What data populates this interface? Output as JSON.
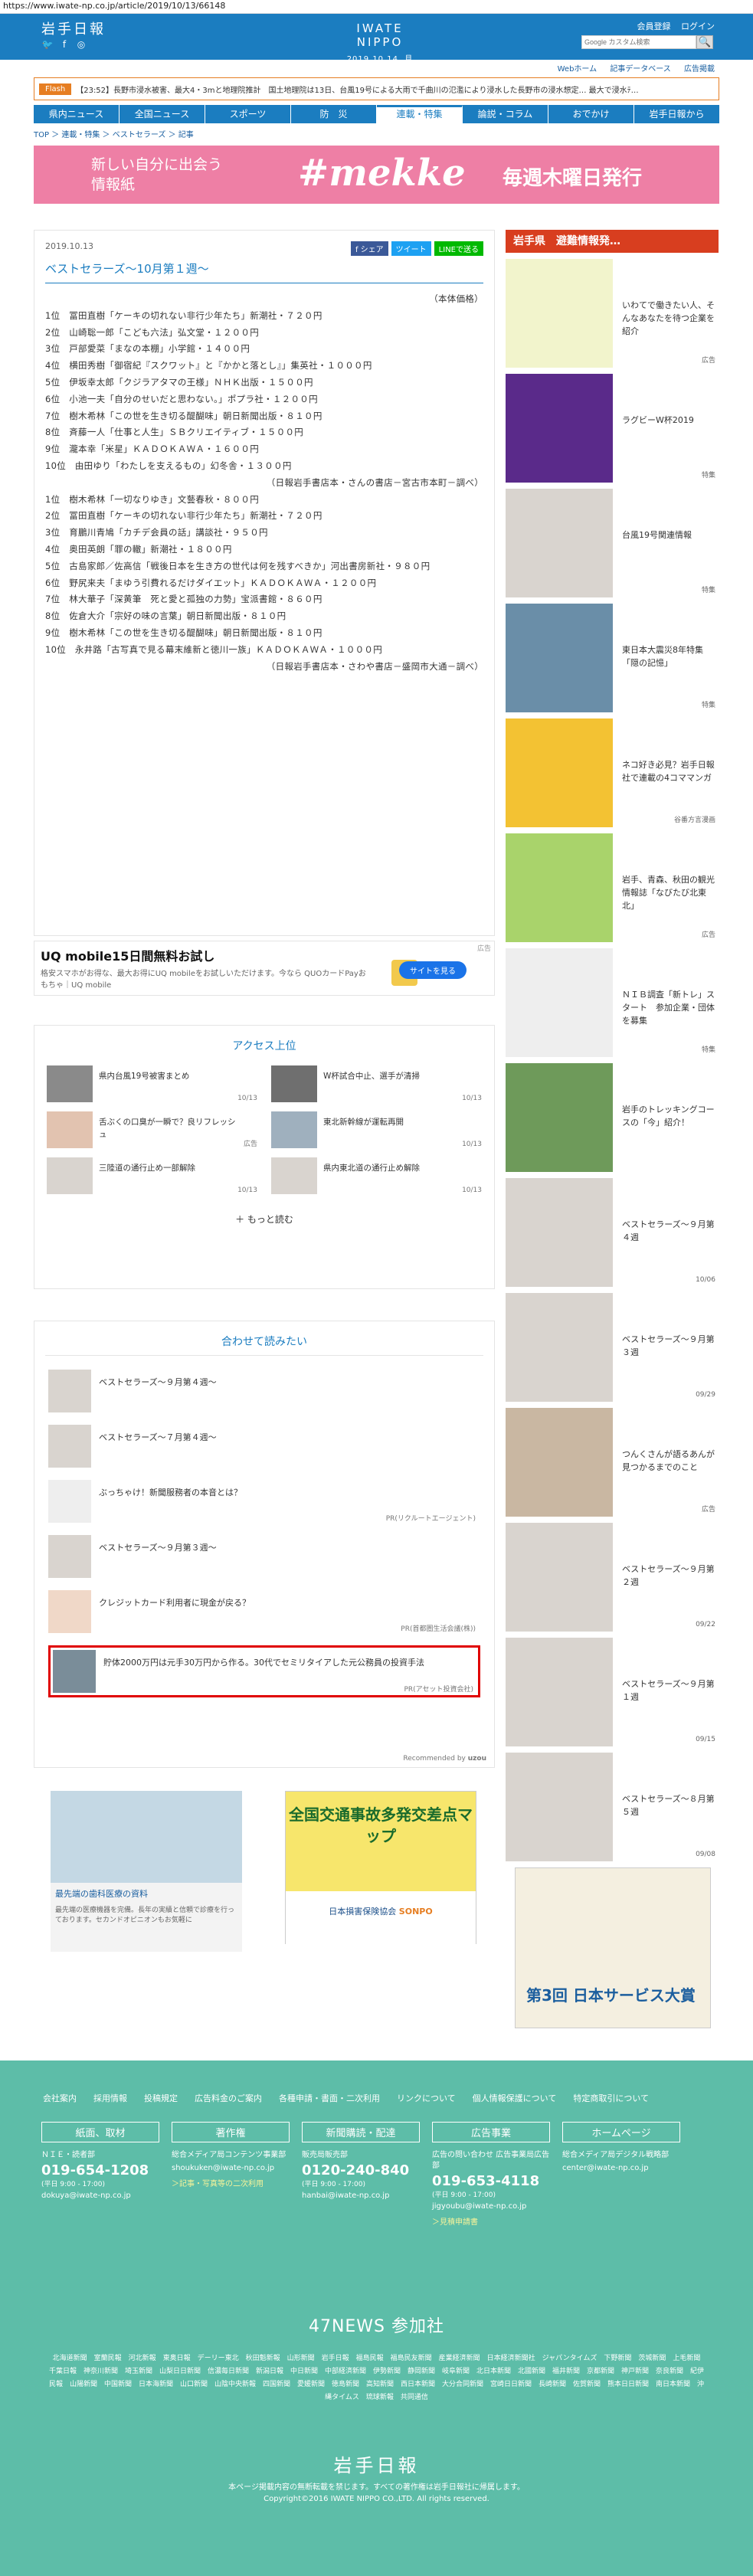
{
  "browser": {
    "url": "https://www.iwate-np.co.jp/article/2019/10/13/66148"
  },
  "header": {
    "logo_jp": "岩手日報",
    "logo_en": "IWATE NIPPO",
    "date": "2019.10.14. 月",
    "register": "会員登録",
    "login": "ログイン",
    "web_home": "Webホーム",
    "news": "記事データベース",
    "ad": "広告掲載",
    "search_placeholder": "Google カスタム検索"
  },
  "flash": {
    "tag": "Flash",
    "text": "【23:52】長野市浸水被害、最大4・3mと地理院推計　国土地理院は13日、台風19号による大雨で千曲川の氾濫により浸水した長野市の浸水想定… 最大で浸水ﾃ…"
  },
  "nav": [
    "県内ニュース",
    "全国ニュース",
    "スポーツ",
    "防　災",
    "連載・特集",
    "論説・コラム",
    "おでかけ",
    "岩手日報から"
  ],
  "breadcrumb": "TOP ＞ 連載・特集 ＞ ベストセラーズ ＞ 記事",
  "banner": {
    "line1": "新しい自分に出会う",
    "line2": "情報紙",
    "brand": "#mekke",
    "furigana": "めっけ",
    "tail": "毎週木曜日発行"
  },
  "article": {
    "date": "2019.10.13",
    "share": [
      "f シェア",
      "ツイート",
      "LINEで送る"
    ],
    "title": "ベストセラーズ～10月第１週～",
    "lines": [
      "（本体価格）",
      "1位　冨田直樹「ケーキの切れない非行少年たち」新潮社・７２０円",
      "2位　山崎聡一郎「こども六法」弘文堂・１２００円",
      "3位　戸部愛菜「まなの本棚」小学館・１４００円",
      "4位　横田秀樹「御宿紀『スクワット』と『かかと落とし』」集英社・１０００円",
      "5位　伊坂幸太郎「クジラアタマの王様」ＮＨＫ出版・１５００円",
      "6位　小池一夫「自分のせいだと思わない。」ポプラ社・１２００円",
      "7位　樹木希林「この世を生き切る醍醐味」朝日新聞出版・８１０円",
      "8位　斉藤一人「仕事と人生」ＳＢクリエイティブ・１５００円",
      "9位　瀧本幸「米星」ＫＡＤＯＫＡＷＡ・１６００円",
      "10位　由田ゆり「わたしを支えるもの」幻冬舎・１３００円",
      "（日報岩手書店本・さんの書店－宮古市本町－調べ）",
      "1位　樹木希林「一切なりゆき」文藝春秋・８００円",
      "2位　冨田直樹「ケーキの切れない非行少年たち」新潮社・７２０円",
      "3位　育鵬川青鳩「カチデ会員の話」講談社・９５０円",
      "4位　奥田英朗「罪の轍」新潮社・１８００円",
      "5位　古島家郎／佐高信「戦後日本を生き方の世代は何を残すべきか」河出書房新社・９８０円",
      "6位　野尻来夫「まゆう引費れるだけダイエット」ＫＡＤＯＫＡＷＡ・１２００円",
      "7位　林大華子「深黄筆　死と愛と孤独の力勢」宝派書館・８６０円",
      "8位　佐倉大介「宗好の味の言葉」朝日新聞出版・８１０円",
      "9位　樹木希林「この世を生き切る醍醐味」朝日新聞出版・８１０円",
      "10位　永井路「古写真で見る幕末維新と徳川一族」ＫＡＤＯＫＡＷＡ・１０００円",
      "（日報岩手書店本・さわや書店－盛岡市大通－調べ）"
    ]
  },
  "uq_ad": {
    "title": "UQ mobile15日間無料お試し",
    "desc": "格安スマホがお得な、最大お得にUQ mobileをお試しいただけます。今なら QUOカードPayおもちゃ｜UQ mobile",
    "button": "サイトを見る",
    "label": "広告"
  },
  "access": {
    "title": "アクセス上位",
    "items": [
      {
        "text": "県内台風19号被害まとめ",
        "date": "10/13"
      },
      {
        "text": "W杯試合中止、選手が清掃",
        "date": "10/13"
      },
      {
        "text": "舌ぶくの口臭が一瞬で？良リフレッシュ",
        "date": "広告"
      },
      {
        "text": "東北新幹線が運転再開",
        "date": "10/13"
      },
      {
        "text": "三陸道の通行止め一部解除",
        "date": "10/13"
      },
      {
        "text": "県内東北道の通行止め解除",
        "date": "10/13"
      }
    ],
    "more": "もっと読む"
  },
  "awase": {
    "title": "合わせて読みたい",
    "items": [
      {
        "text": "ベストセラーズ～９月第４週～",
        "pr": ""
      },
      {
        "text": "ベストセラーズ～７月第４週～",
        "pr": ""
      },
      {
        "text": "ぶっちゃけ！新聞服務者の本音とは？",
        "pr": "PR(リクルートエージェント)"
      },
      {
        "text": "ベストセラーズ～９月第３週～",
        "pr": ""
      },
      {
        "text": "クレジットカード利用者に現金が戻る？",
        "pr": "PR(首都圏生活会議(株))"
      },
      {
        "text": "貯体2000万円は元手30万円から作る。30代でセミリタイアした元公務員の投資手法",
        "pr": "PR(アセット投資会社)"
      }
    ],
    "recommended": "Recommended by"
  },
  "bottom_ads": {
    "ad1_title": "最先端の歯科医療の資料",
    "ad1_desc": "最先端の医療機器を完備。長年の実績と信頼で診療を行っております。セカンドオピニオンもお気軽に",
    "ad2_title": "全国交通事故多発交差点マップ",
    "ad2_org": "日本損害保険協会",
    "ad2_brand": "SONPO"
  },
  "side": {
    "header": "岩手県　避難情報発…",
    "items": [
      {
        "text": "いわてで働きたい人、そんなあなたを待つ企業を紹介",
        "label": "広告"
      },
      {
        "text": "ラグビーW杯2019",
        "label": "特集"
      },
      {
        "text": "台風19号関連情報",
        "label": "特集"
      },
      {
        "text": "東日本大震災8年特集「隠の記憶」",
        "label": "特集"
      },
      {
        "text": "ネコ好き必見？岩手日報社で連載の4コママンガ",
        "label": "谷番方言漫画"
      },
      {
        "text": "岩手、青森、秋田の観光情報誌「なびたび北東北」",
        "label": "広告"
      },
      {
        "text": "ＮＩＢ調査「新トレ」スタート　参加企業・団体を募集",
        "label": "特集"
      },
      {
        "text": "岩手のトレッキングコースの「今」紹介！",
        "label": ""
      },
      {
        "text": "ベストセラーズ～９月第４週",
        "label": "10/06"
      },
      {
        "text": "ベストセラーズ～９月第３週",
        "label": "09/29"
      },
      {
        "text": "つんくさんが語るあんが見つかるまでのこと",
        "label": "広告"
      },
      {
        "text": "ベストセラーズ～９月第２週",
        "label": "09/22"
      },
      {
        "text": "ベストセラーズ～９月第１週",
        "label": "09/15"
      },
      {
        "text": "ベストセラーズ～８月第５週",
        "label": "09/08"
      }
    ],
    "bottom_ad": "第3回 日本サービス大賞"
  },
  "footer": {
    "links": [
      "会社案内",
      "採用情報",
      "投稿規定",
      "広告料金のご案内",
      "各種申請・書面・二次利用",
      "リンクについて",
      "個人情報保護について",
      "特定商取引について"
    ],
    "cols": [
      {
        "h": "紙面、取材",
        "s": "ＮＩＥ・読者部",
        "ph": "019-654-1208",
        "hr": "(平日 9:00 - 17:00)",
        "ml": "dokuya@iwate-np.co.jp",
        "lk": ""
      },
      {
        "h": "著作権",
        "s": "総合メディア局コンテンツ事業部",
        "ph": "",
        "hr": "",
        "ml": "shoukuken@iwate-np.co.jp",
        "lk": "＞記事・写真等の二次利用"
      },
      {
        "h": "新聞購読・配達",
        "s": "販売局販売部",
        "ph": "0120-240-840",
        "hr": "(平日 9:00 - 17:00)",
        "ml": "hanbai@iwate-np.co.jp",
        "lk": ""
      },
      {
        "h": "広告事業",
        "s": "広告の問い合わせ 広告事業局広告部",
        "ph": "019-653-4118",
        "hr": "(平日 9:00 - 17:00)",
        "ml": "jigyoubu@iwate-np.co.jp",
        "lk": "＞見積申請書"
      },
      {
        "h": "ホームページ",
        "s": "総合メディア局デジタル戦略部",
        "ph": "",
        "hr": "",
        "ml": "center@iwate-np.co.jp",
        "lk": ""
      }
    ],
    "n47": "47NEWS 参加社",
    "n47_members": "北海道新聞　室蘭民報　河北新報　東奥日報　デーリー東北　秋田魁新報　山形新聞　岩手日報　福島民報　福島民友新聞　産業経済新聞　日本経済新聞社　ジャパンタイムズ　下野新聞　茨城新聞　上毛新聞　千葉日報　神奈川新聞　埼玉新聞　山梨日日新聞　信濃毎日新聞　新潟日報　中日新聞　中部経済新聞　伊勢新聞　静岡新聞　岐阜新聞　北日本新聞　北國新聞　福井新聞　京都新聞　神戸新聞　奈良新聞　紀伊民報　山陽新聞　中国新聞　日本海新聞　山口新聞　山陰中央新報　四国新聞　愛媛新聞　徳島新聞　高知新聞　西日本新聞　大分合同新聞　宮崎日日新聞　長崎新聞　佐賀新聞　熊本日日新聞　南日本新聞　沖縄タイムス　琉球新報　共同通信",
    "logo": "岩手日報",
    "copy1": "本ページ掲載内容の無断転載を禁じます。すべての著作権は岩手日報社に帰属します。",
    "copy2": "Copyright©2016 IWATE NIPPO CO.,LTD. All rights reserved."
  }
}
